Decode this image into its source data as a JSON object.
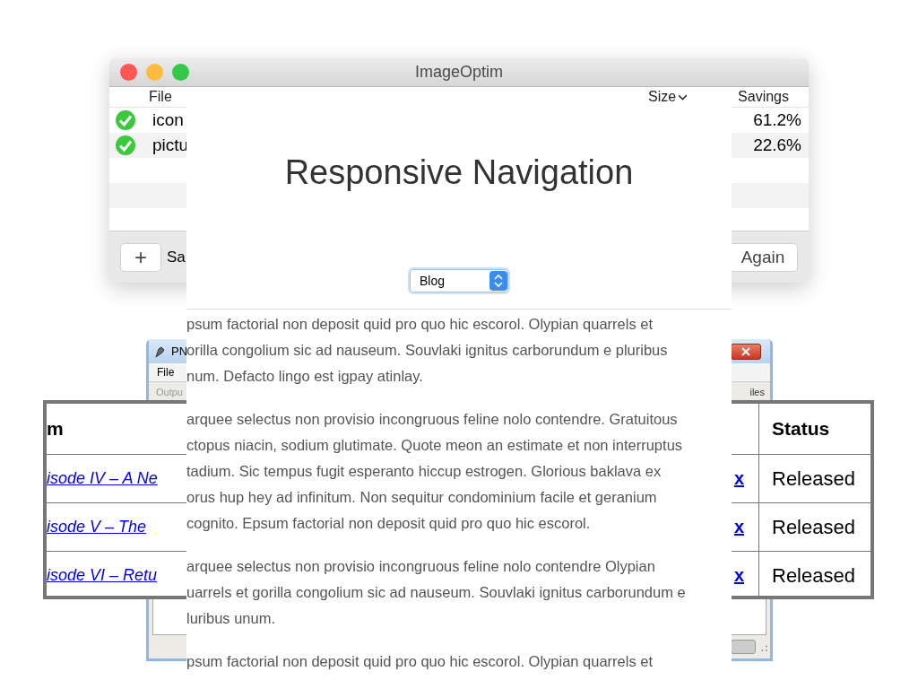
{
  "image_optim": {
    "title": "ImageOptim",
    "columns": [
      "File",
      "Size",
      "Savings"
    ],
    "rows": [
      {
        "file": "icon",
        "savings": "61.2%"
      },
      {
        "file": "pictu",
        "savings": "22.6%"
      }
    ],
    "add_button": "+",
    "footer_text": "Sa",
    "again_button": "Again"
  },
  "pn_window": {
    "title": "PN",
    "menu": [
      "File"
    ],
    "pane_left": "Outpu",
    "pane_right": "iles"
  },
  "table": {
    "columns": [
      "m",
      "Status"
    ],
    "rows": [
      {
        "title": "isode IV – A Ne",
        "link": "x",
        "status": "Released"
      },
      {
        "title": "isode V – The",
        "link": "x",
        "status": "Released"
      },
      {
        "title": "isode VI – Retu",
        "link": "x",
        "status": "Released"
      }
    ]
  },
  "web_page": {
    "title": "Responsive Navigation",
    "nav_select": {
      "value": "Blog"
    },
    "paragraphs": [
      {
        "lines": [
          "psum factorial non deposit quid pro quo hic escorol. Olypian quarrels et",
          "orilla congolium sic ad nauseum. Souvlaki ignitus carborundum e pluribus",
          "num. Defacto lingo est igpay atinlay."
        ]
      },
      {
        "lines": [
          "arquee selectus non provisio incongruous feline nolo contendre. Gratuitous",
          "ctopus niacin, sodium glutimate. Quote meon an estimate et non interruptus",
          "tadium. Sic tempus fugit esperanto hiccup estrogen. Glorious baklava ex",
          "orus hup hey ad infinitum. Non sequitur condominium facile et geranium",
          "cognito. Epsum factorial non deposit quid pro quo hic escorol."
        ]
      },
      {
        "lines": [
          "arquee selectus non provisio incongruous feline nolo contendre Olypian",
          "uarrels et gorilla congolium sic ad nauseum. Souvlaki ignitus carborundum e",
          "luribus unum."
        ]
      },
      {
        "lines": [
          "psum factorial non deposit quid pro quo hic escorol. Olypian quarrels et"
        ]
      }
    ]
  }
}
